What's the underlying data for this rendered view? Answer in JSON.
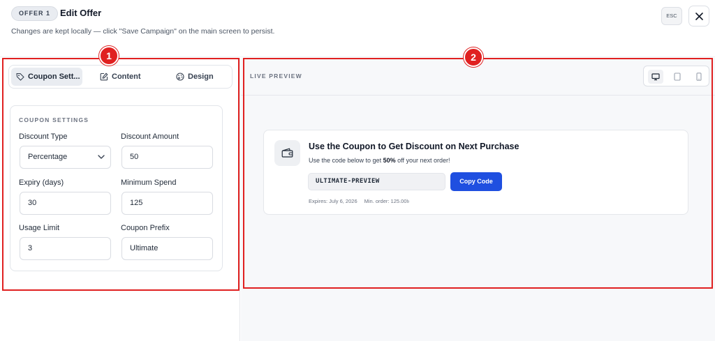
{
  "header": {
    "badge": "OFFER 1",
    "title": "Edit Offer",
    "subtitle": "Changes are kept locally — click \"Save Campaign\" on the main screen to persist.",
    "esc_label": "ESC",
    "close_icon": "close-icon"
  },
  "tabs": [
    {
      "label": "Coupon Sett...",
      "icon": "tag-icon",
      "active": true
    },
    {
      "label": "Content",
      "icon": "edit-icon",
      "active": false
    },
    {
      "label": "Design",
      "icon": "palette-icon",
      "active": false
    }
  ],
  "coupon_settings": {
    "section_title": "COUPON SETTINGS",
    "discount_type": {
      "label": "Discount Type",
      "value": "Percentage"
    },
    "discount_amount": {
      "label": "Discount Amount",
      "value": "50"
    },
    "expiry_days": {
      "label": "Expiry (days)",
      "value": "30"
    },
    "minimum_spend": {
      "label": "Minimum Spend",
      "value": "125"
    },
    "usage_limit": {
      "label": "Usage Limit",
      "value": "3"
    },
    "coupon_prefix": {
      "label": "Coupon Prefix",
      "value": "Ultimate"
    }
  },
  "preview": {
    "section_title": "LIVE PREVIEW",
    "devices": [
      "desktop-icon",
      "tablet-icon",
      "mobile-icon"
    ],
    "active_device": "desktop",
    "coupon": {
      "title": "Use the Coupon to Get Discount on Next Purchase",
      "desc_prefix": "Use the code below to get ",
      "desc_highlight": "50%",
      "desc_suffix": " off your next order!",
      "code": "ULTIMATE-PREVIEW",
      "copy_label": "Copy Code",
      "expires": "Expires: July 6, 2026",
      "min_order": "Min. order: 125.00৳"
    }
  },
  "annotations": {
    "marker_1": "1",
    "marker_2": "2",
    "color": "#e02020"
  },
  "colors": {
    "primary": "#1f4fe0",
    "annotation": "#e02020"
  }
}
